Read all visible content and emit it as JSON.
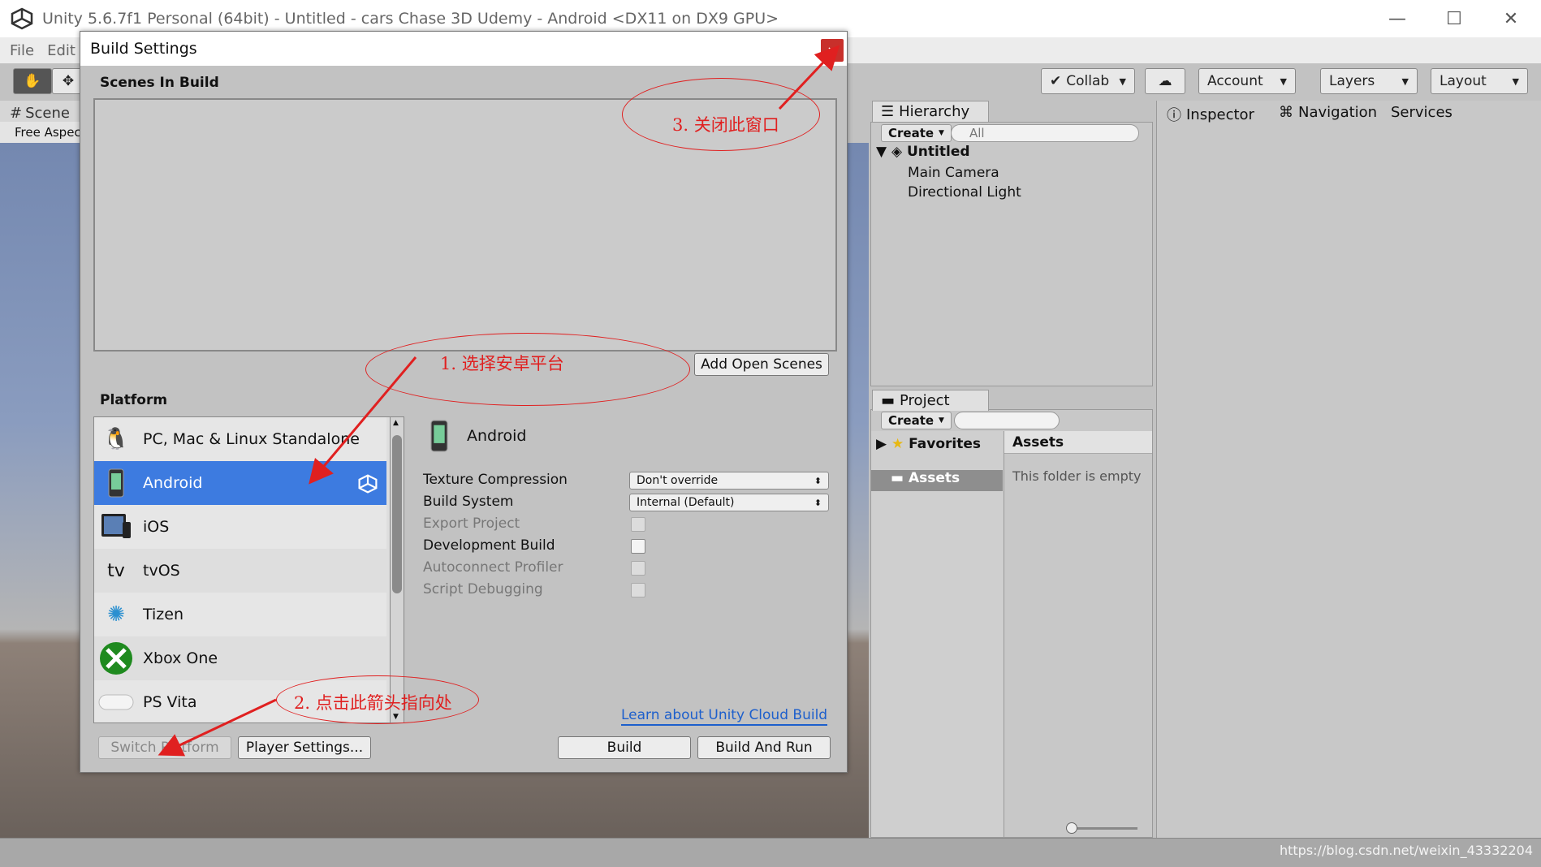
{
  "window": {
    "title": "Unity 5.6.7f1 Personal (64bit) - Untitled - cars Chase 3D Udemy - Android <DX11 on DX9 GPU>",
    "minimize": "—",
    "maximize": "☐",
    "close": "✕"
  },
  "menu": [
    "File",
    "Edit"
  ],
  "toolbar": {
    "collab": "Collab",
    "account": "Account",
    "layers": "Layers",
    "layout": "Layout"
  },
  "scene": {
    "tab": "Scene",
    "aspect": "Free Aspec"
  },
  "hierarchy": {
    "tab": "Hierarchy",
    "create": "Create",
    "search_placeholder": "All",
    "scene_name": "Untitled",
    "items": [
      "Main Camera",
      "Directional Light"
    ]
  },
  "project": {
    "tab": "Project",
    "create": "Create",
    "favorites": "Favorites",
    "assets_tree": "Assets",
    "assets_header": "Assets",
    "empty_text": "This folder is empty"
  },
  "inspector": {
    "tabs": [
      "Inspector",
      "Navigation",
      "Services"
    ]
  },
  "dialog": {
    "title": "Build Settings",
    "close": "×",
    "scenes_label": "Scenes In Build",
    "add_open_scenes": "Add Open Scenes",
    "platform_label": "Platform",
    "platforms": [
      {
        "name": "PC, Mac & Linux Standalone",
        "icon": "tux-icon"
      },
      {
        "name": "Android",
        "icon": "android-icon"
      },
      {
        "name": "iOS",
        "icon": "ios-icon"
      },
      {
        "name": "tvOS",
        "icon": "appletv-icon"
      },
      {
        "name": "Tizen",
        "icon": "tizen-icon"
      },
      {
        "name": "Xbox One",
        "icon": "xbox-icon"
      },
      {
        "name": "PS Vita",
        "icon": "psvita-icon"
      }
    ],
    "selected_platform": "Android",
    "options": {
      "texture_compression": "Texture Compression",
      "texture_compression_value": "Don't override",
      "build_system": "Build System",
      "build_system_value": "Internal (Default)",
      "export_project": "Export Project",
      "development_build": "Development Build",
      "autoconnect_profiler": "Autoconnect Profiler",
      "script_debugging": "Script Debugging"
    },
    "cloud_link": "Learn about Unity Cloud Build",
    "switch_platform": "Switch Platform",
    "player_settings": "Player Settings...",
    "build": "Build",
    "build_and_run": "Build And Run"
  },
  "annotations": {
    "step1": "1. 选择安卓平台",
    "step2": "2. 点击此箭头指向处",
    "step3": "3. 关闭此窗口",
    "color": "#e02020"
  },
  "watermark": "https://blog.csdn.net/weixin_43332204"
}
